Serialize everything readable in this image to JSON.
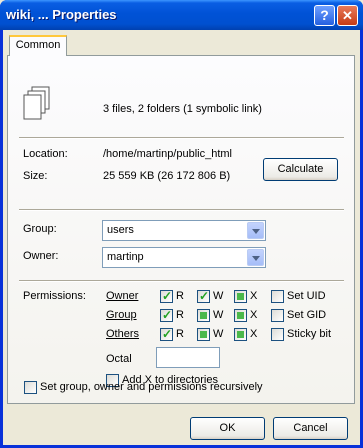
{
  "window": {
    "title": "wiki, ... Properties",
    "help": "?",
    "close": "✕"
  },
  "tab": "Common",
  "summary": "3 files, 2 folders (1 symbolic link)",
  "location": {
    "label": "Location:",
    "value": "/home/martinp/public_html"
  },
  "size": {
    "label": "Size:",
    "value": "25 559 KB (26 172 806 B)",
    "calculate": "Calculate"
  },
  "group": {
    "label": "Group:",
    "value": "users"
  },
  "owner": {
    "label": "Owner:",
    "value": "martinp"
  },
  "permissions": {
    "label": "Permissions:",
    "rows": [
      {
        "name": "Owner",
        "r": "R",
        "w": "W",
        "x": "X",
        "special": "Set UID",
        "r_state": "checked",
        "w_state": "checked",
        "x_state": "indeterminate",
        "special_state": "unchecked"
      },
      {
        "name": "Group",
        "r": "R",
        "w": "W",
        "x": "X",
        "special": "Set GID",
        "r_state": "checked",
        "w_state": "indeterminate",
        "x_state": "indeterminate",
        "special_state": "unchecked"
      },
      {
        "name": "Others",
        "r": "R",
        "w": "W",
        "x": "X",
        "special": "Sticky bit",
        "r_state": "checked",
        "w_state": "indeterminate",
        "x_state": "indeterminate",
        "special_state": "unchecked"
      }
    ],
    "octal_label": "Octal",
    "octal_value": "",
    "add_x": "Add X to directories"
  },
  "recursive": "Set group, owner and permissions recursively",
  "buttons": {
    "ok": "OK",
    "cancel": "Cancel"
  }
}
